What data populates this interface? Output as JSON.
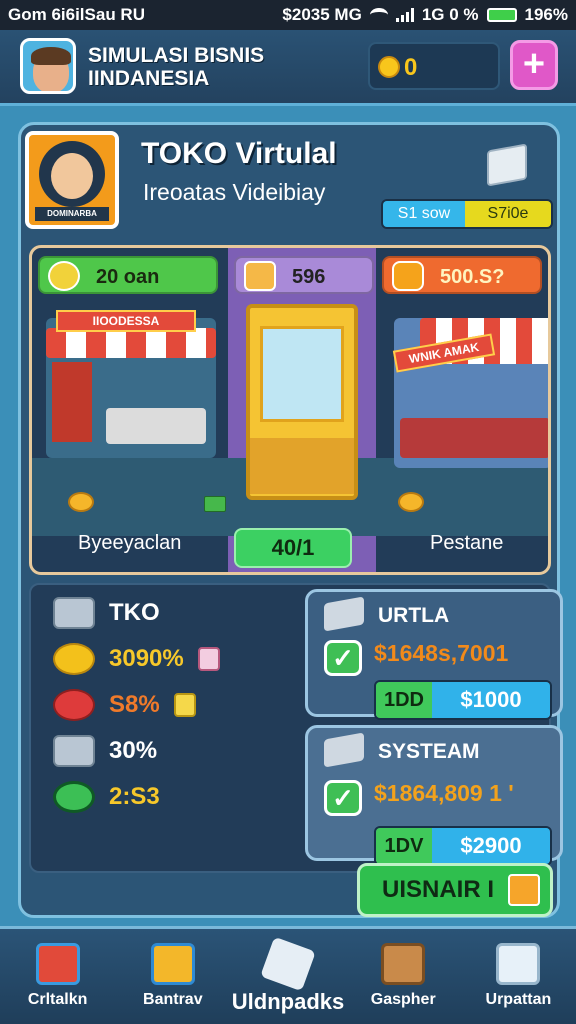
{
  "status_bar": {
    "left": "Gom 6i6ilSau  RU",
    "right": "$2035 MG",
    "signal_text": "1G 0 %",
    "battery": "196%"
  },
  "header": {
    "title_line1": "SIMULASI BISNIS",
    "title_line2": "IINDANESIA",
    "coins": "0",
    "add_label": "+"
  },
  "shop": {
    "title": "TOKO Virtulal",
    "subtitle": "Ireoatas Videibiay",
    "logo_tag": "DOMINARBA",
    "pill_left": "S1 sow",
    "pill_right": "S7i0e"
  },
  "shops": {
    "badge1": "20 oan",
    "badge2": "596",
    "badge3": "500.S?",
    "sign1": "IIOODESSA",
    "sign3": "WNIK AMAK",
    "label1": "Byeeyaclan",
    "label3": "Pestane",
    "mid_button": "40/1"
  },
  "stats": {
    "rows": [
      {
        "icon": "block-icon",
        "value": "TKO"
      },
      {
        "icon": "star-icon",
        "value": "3090%"
      },
      {
        "icon": "pill-icon",
        "value": "S8%"
      },
      {
        "icon": "block-icon",
        "value": "30%"
      },
      {
        "icon": "money-icon",
        "value": "2:S3"
      }
    ],
    "card1": {
      "title": "URTLA",
      "price": "$1648s,7001",
      "bar_left": "1DD",
      "bar_right": "$1000"
    },
    "card2": {
      "title": "SYSTEAM",
      "price": "$1864,809  1 '",
      "bar_left": "1DV",
      "bar_right": "$2900"
    },
    "main_button": "UISNAIR I"
  },
  "nav": {
    "items": [
      {
        "label": "Crltalkn",
        "icon": "shop-icon"
      },
      {
        "label": "Bantrav",
        "icon": "store-icon"
      },
      {
        "label": "Uldnpadks",
        "icon": "plane-icon"
      },
      {
        "label": "Gaspher",
        "icon": "box-icon"
      },
      {
        "label": "Urpattan",
        "icon": "gear-face-icon"
      }
    ]
  },
  "colors": {
    "background": "#3b8fb8",
    "panel": "#2c5576",
    "accent_green": "#2fbf4e",
    "accent_pink": "#e058c8",
    "accent_gold": "#f8c61c"
  }
}
